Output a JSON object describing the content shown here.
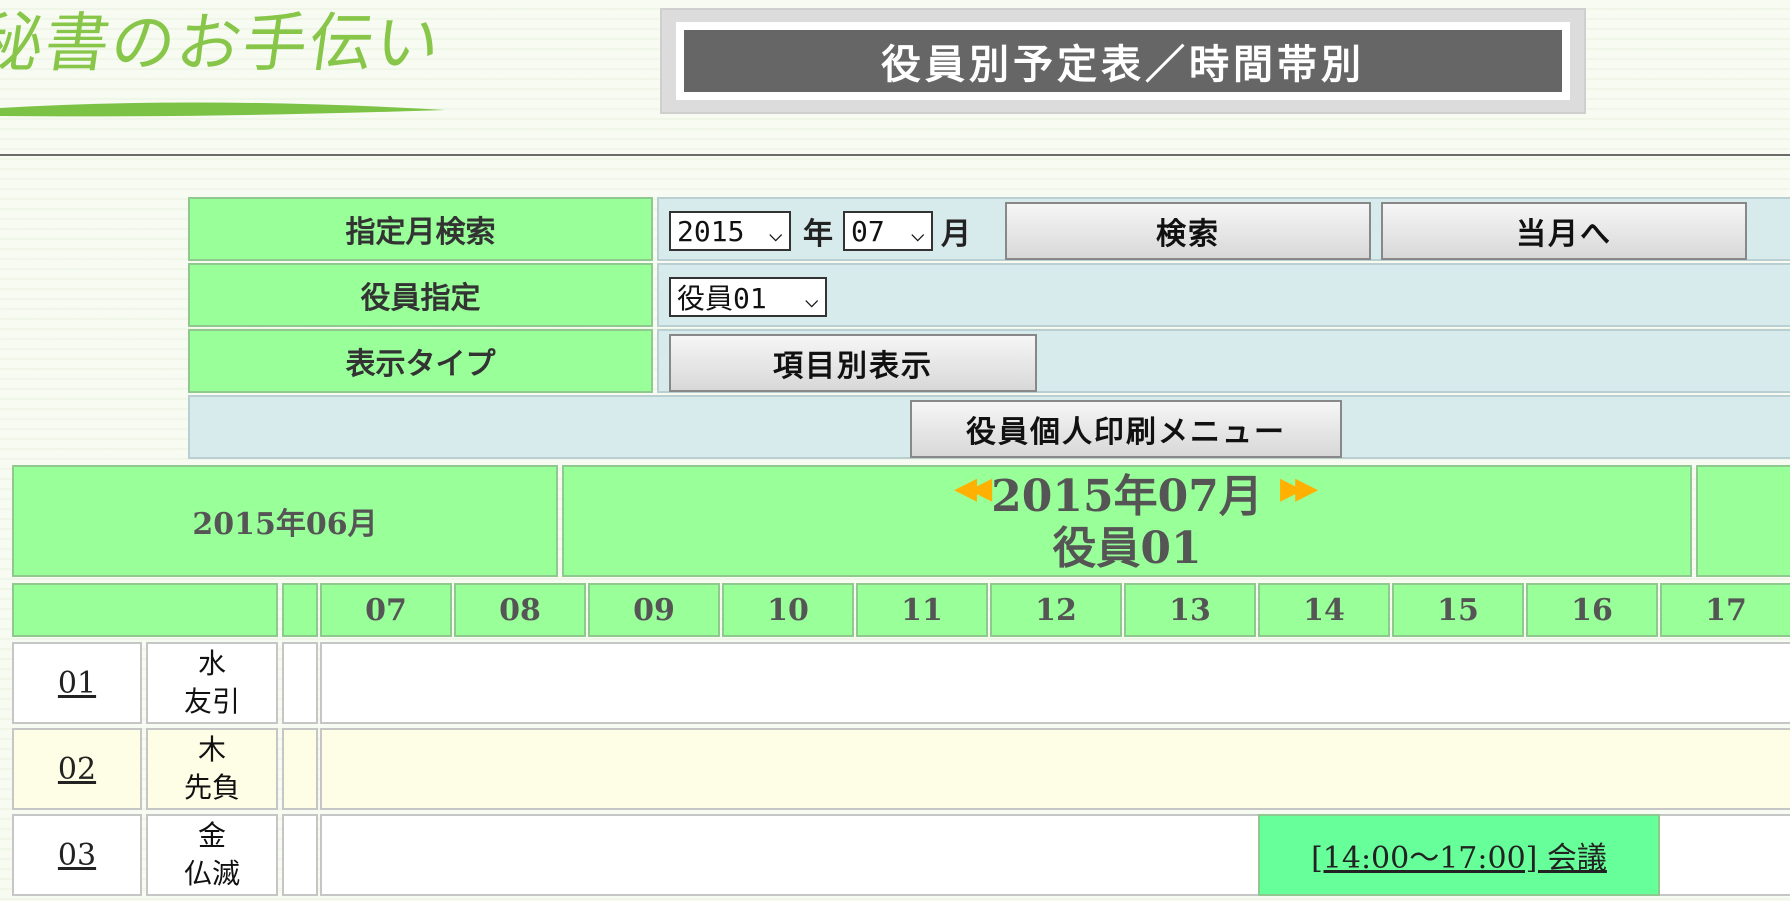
{
  "logo": {
    "text": "秘書のお手伝い"
  },
  "title": "役員別予定表／時間帯別",
  "form": {
    "month_search_label": "指定月検索",
    "year_value": "2015",
    "year_unit": "年",
    "month_value": "07",
    "month_unit": "月",
    "search_button": "検索",
    "current_month_button": "当月へ",
    "officer_label": "役員指定",
    "officer_value": "役員01",
    "display_type_label": "表示タイプ",
    "display_type_button": "項目別表示",
    "print_menu_button": "役員個人印刷メニュー"
  },
  "calendar": {
    "prev_month": "2015年06月",
    "current_month": "2015年07月",
    "officer": "役員01",
    "hours": [
      "07",
      "08",
      "09",
      "10",
      "11",
      "12",
      "13",
      "14",
      "15",
      "16",
      "17"
    ],
    "days": [
      {
        "day": "01",
        "weekday": "水",
        "rokuyo": "友引",
        "event": ""
      },
      {
        "day": "02",
        "weekday": "木",
        "rokuyo": "先負",
        "event": ""
      },
      {
        "day": "03",
        "weekday": "金",
        "rokuyo": "仏滅",
        "event": "[14:00〜17:00] 会議"
      }
    ]
  },
  "colors": {
    "header_green": "#99ff99",
    "event_green": "#66ff99",
    "panel_blue": "#d7eaec",
    "title_gray": "#666666",
    "alt_row": "#fefde6"
  }
}
